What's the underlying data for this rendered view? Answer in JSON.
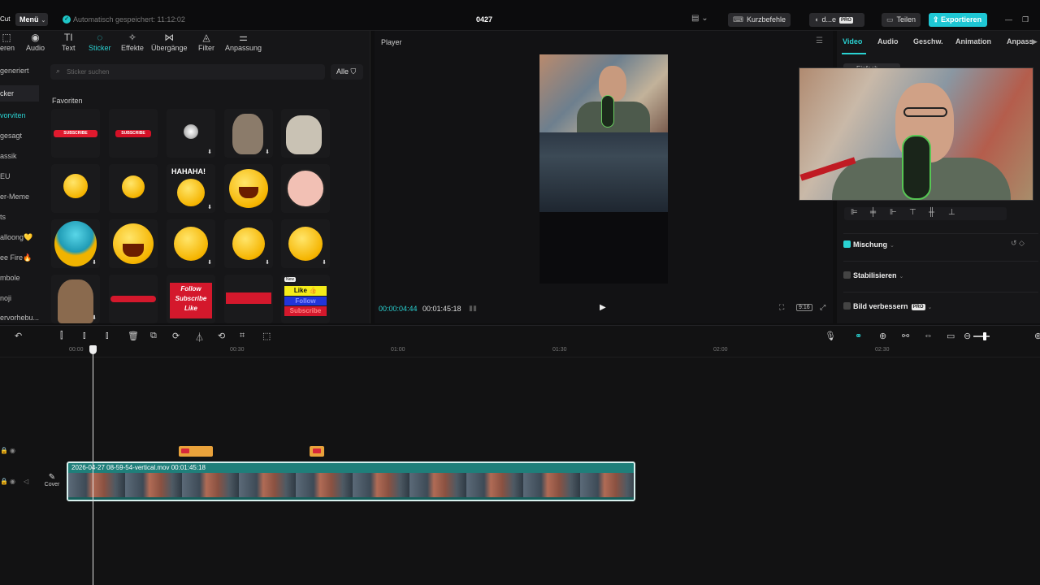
{
  "topbar": {
    "cut_label": "Cut",
    "menu_label": "Menü",
    "autosave_text": "Automatisch gespeichert: 11:12:02",
    "project_title": "0427",
    "shortcuts_label": "Kurzbefehle",
    "user_label": "d...e",
    "pro_badge": "PRO",
    "share_label": "Teilen",
    "export_label": "Exportieren",
    "minimize_icon": "minimize-icon",
    "maximize_icon": "maximize-icon"
  },
  "left_tabs": [
    {
      "label": "ieren",
      "icon": "import-icon"
    },
    {
      "label": "Audio",
      "icon": "audio-icon"
    },
    {
      "label": "Text",
      "icon": "text-icon"
    },
    {
      "label": "Sticker",
      "icon": "sticker-icon"
    },
    {
      "label": "Effekte",
      "icon": "effects-icon"
    },
    {
      "label": "Übergänge",
      "icon": "transitions-icon"
    },
    {
      "label": "Filter",
      "icon": "filter-icon"
    },
    {
      "label": "Anpassung",
      "icon": "adjust-icon"
    }
  ],
  "categories": [
    "generiert",
    "cker",
    "vorviten",
    "gesagt",
    "assik",
    "EU",
    "er-Meme",
    "ts",
    "alloong💛",
    "ee Fire🔥",
    "mbole",
    "noji",
    "ervorhebu..."
  ],
  "search": {
    "placeholder": "Sticker suchen",
    "filter_label": "Alle"
  },
  "favorites_label": "Favoriten",
  "stickers": {
    "subscribe_text": "SUBSCRIBE",
    "hahaha_text": "HAHAHA!",
    "follow": "Follow",
    "subscribe": "Subscribe",
    "like": "Like",
    "like_thumb": "Like 👍",
    "new_badge": "New"
  },
  "player": {
    "title": "Player",
    "current_time": "00:00:04:44",
    "duration": "00:01:45:18",
    "ratio": "9:16"
  },
  "right_tabs": [
    "Video",
    "Audio",
    "Geschw.",
    "Animation",
    "Anpass"
  ],
  "right_panel": {
    "basic_label": "Einfach",
    "blend_label": "Mischung",
    "stabilize_label": "Stabilisieren",
    "enhance_label": "Bild verbessern",
    "pro_badge": "PRO"
  },
  "timeline": {
    "ruler": [
      "00:00",
      "00:30",
      "01:00",
      "01:30",
      "02:00",
      "02:30"
    ],
    "clip_label": "2026-04-27 08-59-54-vertical.mov  00:01:45:18",
    "cover_label": "Cover"
  },
  "colors": {
    "accent": "#2ad2d2",
    "export_bg": "#1ec7d4",
    "clip_bg": "#1f7f7a",
    "sticker_clip": "#e9a23b"
  }
}
